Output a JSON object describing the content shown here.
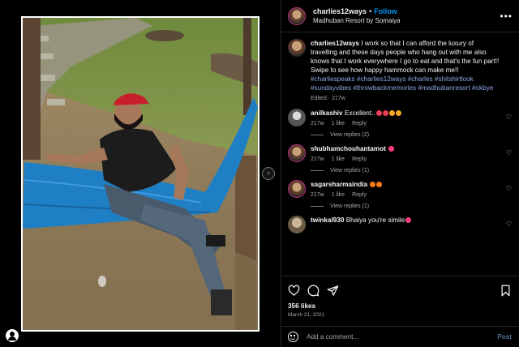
{
  "header": {
    "username": "charlies12ways",
    "separator": "•",
    "follow_label": "Follow",
    "location": "Madhuban Resort by Somaiya",
    "more_icon": "more-dots-icon"
  },
  "caption": {
    "username": "charlies12ways",
    "text": " I work so that I can afford the luxury of travelling and these days people who hang out with me also knows that I work everywhere I go to eat and that's the fun part!! Swipe to see how happy hammock can make me!!",
    "hashtags": "#charliespeaks #charlies12ways #charles #shitshirtlook #sundayvibes #throwbackmemories #madhubanresort #okbye",
    "meta": "Edited · 217w"
  },
  "comments": [
    {
      "username": "anilkashiv",
      "text": " Excellent..",
      "emoji_colors": [
        "#e94057",
        "#e94057",
        "#f5a623",
        "#f5a623"
      ],
      "age": "217w",
      "likes": "1 like",
      "reply_label": "Reply",
      "view_replies": "View replies (2)"
    },
    {
      "username": "shubhamchouhantamot",
      "text": " ",
      "emoji_colors": [
        "#ff3b7a"
      ],
      "age": "217w",
      "likes": "1 like",
      "reply_label": "Reply",
      "view_replies": "View replies (1)"
    },
    {
      "username": "sagarsharmaindia",
      "text": " ",
      "emoji_colors": [
        "#ff7a1a",
        "#ff7a1a"
      ],
      "age": "217w",
      "likes": "1 like",
      "reply_label": "Reply",
      "view_replies": "View replies (1)"
    },
    {
      "username": "twinkal930",
      "text": " Bhaiya you're simile",
      "emoji_colors": [
        "#ff3b7a"
      ],
      "age": "",
      "likes": "",
      "reply_label": "",
      "view_replies": ""
    }
  ],
  "actions": {
    "icons": [
      "heart-icon",
      "comment-icon",
      "share-icon",
      "bookmark-icon"
    ],
    "likes": "356 likes",
    "date": "March 21, 2021"
  },
  "composer": {
    "placeholder": "Add a comment...",
    "post_label": "Post"
  },
  "colors": {
    "follow": "#0095f6",
    "hashtag": "#8ea6e0",
    "hammock": "#1f7fc4",
    "cap": "#c8202a"
  }
}
